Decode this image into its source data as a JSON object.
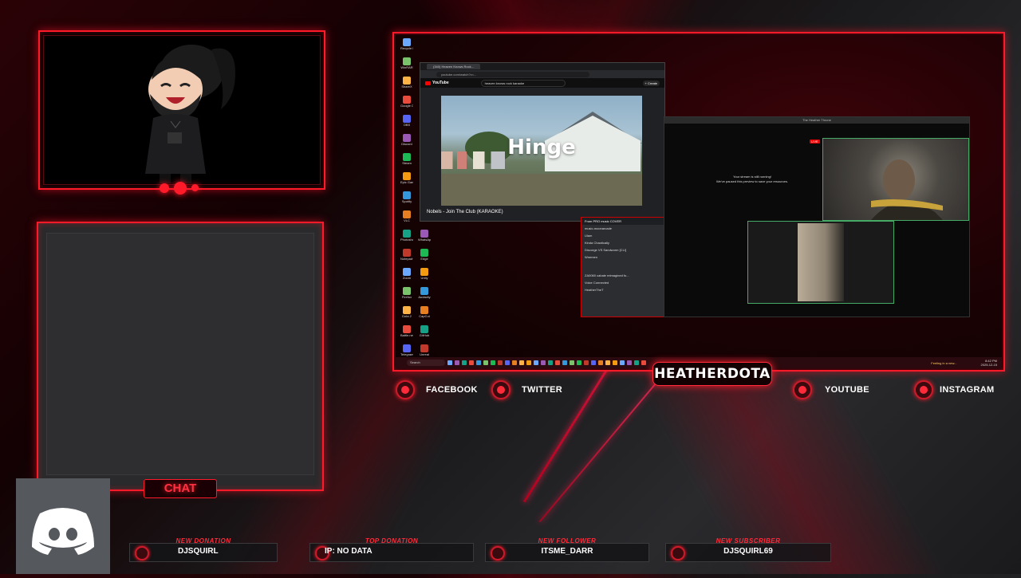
{
  "overlay": {
    "channel_name": "HEATHERDOTA",
    "chat_label": "CHAT",
    "socials": {
      "facebook": "FACEBOOK",
      "twitter": "TWITTER",
      "youtube": "YOUTUBE",
      "instagram": "INSTAGRAM"
    },
    "alerts": [
      {
        "tag": "NEW DONATION",
        "value": "DJSQUIRL"
      },
      {
        "tag": "TOP DONATION",
        "value": "IP: NO DATA"
      },
      {
        "tag": "NEW FOLLOWER",
        "value": "ITSME_DARR"
      },
      {
        "tag": "NEW SUBSCRIBER",
        "value": "DJSQUIRL69"
      }
    ],
    "colors": {
      "accent": "#ff1a2a",
      "discord_tile": "#55585d"
    }
  },
  "browser": {
    "tab_title": "(340) Heaven Knows Rock...",
    "address": "youtube.com/watch?v=...",
    "site": "YouTube",
    "search": "heaven knows rock karaoke",
    "create_label": "+ Create",
    "ad_brand": "Hinge",
    "video_title": "Nobels - Join The Club (KARAOKE)"
  },
  "stream_window": {
    "title": "The Heather Throne",
    "live_badge": "LIVE",
    "message_line1": "Your stream is still running!",
    "message_line2": "We've paused this preview to save your resources."
  },
  "discord_popup": {
    "header": "From PRO music COVER",
    "rows": [
      "music-moonarcade",
      "Ulam",
      "Kinda Chaotically",
      "Discorge VS Sandworm [CLI]",
      "Wnemen",
      "ZA0060 cabale reimagined fo...",
      "Voice Connected",
      "HeatherTheT"
    ]
  },
  "taskbar": {
    "search": "Search",
    "notice": "Feeling in a new...",
    "time": "8:42 PM",
    "date": "2025-12-15"
  },
  "desktop_icons": [
    "Recycle Bin",
    "WinRAR",
    "ShareX",
    "Google Chrome",
    "OBS",
    "Discord",
    "Steam",
    "Epic Games",
    "Spotify",
    "VLC",
    "Photoshop",
    "Notepad++",
    "Zoom",
    "Firefox",
    "Dota 2",
    "Battle.net",
    "Telegram",
    "WhatsApp",
    "Edge",
    "Unity",
    "Audacity",
    "CapCut",
    "GitHub",
    "Unreal"
  ]
}
